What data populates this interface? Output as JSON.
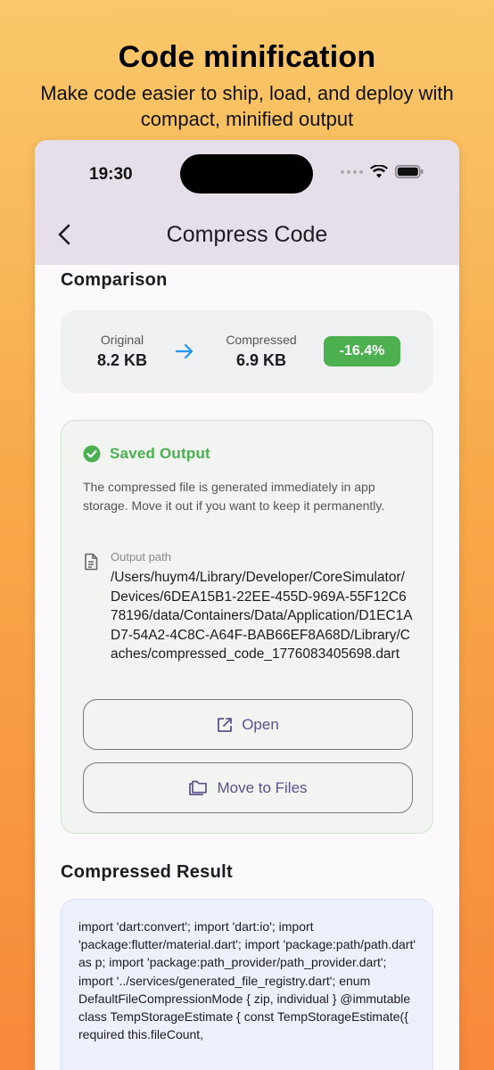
{
  "hero": {
    "title": "Code minification",
    "subtitle": "Make code easier to ship, load, and deploy with compact, minified output"
  },
  "status_bar": {
    "time": "19:30"
  },
  "app_bar": {
    "title": "Compress Code"
  },
  "comparison": {
    "heading": "Comparison",
    "original_label": "Original",
    "original_value": "8.2 KB",
    "compressed_label": "Compressed",
    "compressed_value": "6.9 KB",
    "change_badge": "-16.4%"
  },
  "saved_output": {
    "title": "Saved Output",
    "description": "The compressed file is generated immediately in app storage. Move it out if you want to keep it permanently.",
    "path_label": "Output path",
    "path_value": "/Users/huym4/Library/Developer/CoreSimulator/Devices/6DEA15B1-22EE-455D-969A-55F12C678196/data/Containers/Data/Application/D1EC1AD7-54A2-4C8C-A64F-BAB66EF8A68D/Library/Caches/compressed_code_1776083405698.dart",
    "open_label": "Open",
    "move_label": "Move to Files"
  },
  "result": {
    "heading": "Compressed Result",
    "code": "import 'dart:convert'; import 'dart:io'; import 'package:flutter/material.dart'; import 'package:path/path.dart' as p; import 'package:path_provider/path_provider.dart'; import '../services/generated_file_registry.dart'; enum DefaultFileCompressionMode { zip, individual } @immutable class TempStorageEstimate { const TempStorageEstimate({ required this.fileCount,"
  },
  "colors": {
    "accent_green": "#4caf50",
    "button_text": "#5f4f8c",
    "arrow_blue": "#2196f3"
  },
  "icons": [
    "back-chevron-icon",
    "wifi-icon",
    "battery-icon",
    "arrow-right-icon",
    "check-circle-icon",
    "document-icon",
    "open-external-icon",
    "folder-icon"
  ]
}
